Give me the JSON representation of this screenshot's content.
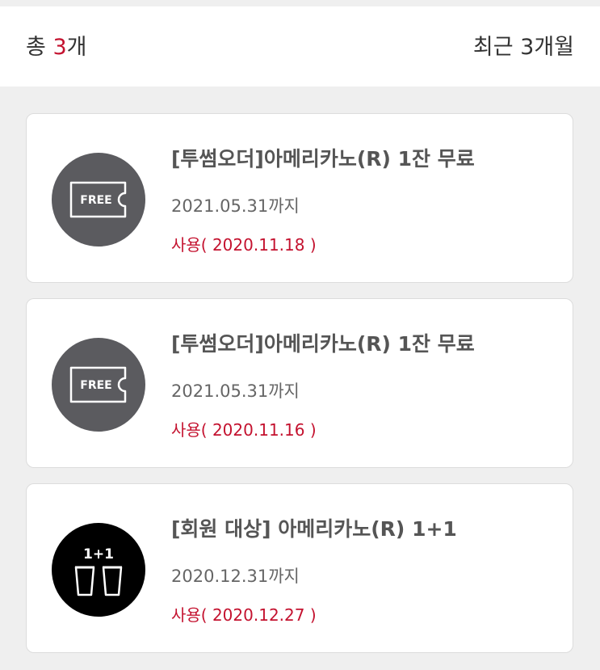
{
  "header": {
    "total_prefix": "총 ",
    "total_count": "3",
    "total_suffix": "개",
    "period_filter": "최근 3개월"
  },
  "coupons": [
    {
      "title": "[투썸오더]아메리카노(R) 1잔 무료",
      "expire": "2021.05.31까지",
      "used": "사용( 2020.11.18 )",
      "icon": "free-ticket-icon",
      "icon_text": "FREE"
    },
    {
      "title": "[투썸오더]아메리카노(R) 1잔 무료",
      "expire": "2021.05.31까지",
      "used": "사용( 2020.11.16 )",
      "icon": "free-ticket-icon",
      "icon_text": "FREE"
    },
    {
      "title": "[회원 대상] 아메리카노(R) 1+1",
      "expire": "2020.12.31까지",
      "used": "사용( 2020.12.27 )",
      "icon": "one-plus-one-cups-icon",
      "icon_text": "1+1"
    }
  ],
  "colors": {
    "accent": "#c4122f",
    "ticket_circle": "#5b5b5f",
    "cups_circle": "#000000"
  }
}
